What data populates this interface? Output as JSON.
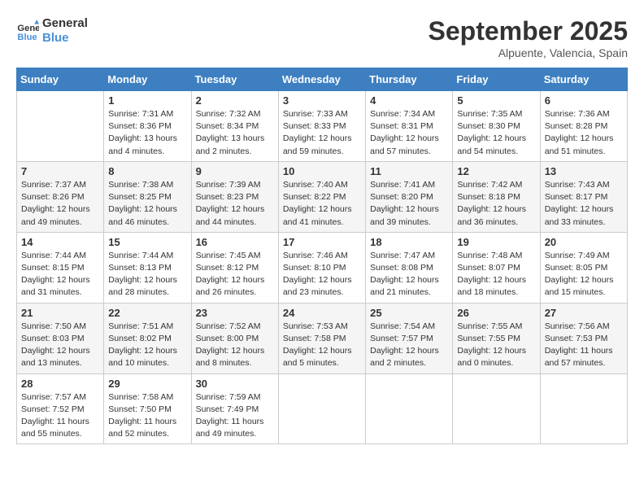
{
  "header": {
    "logo_line1": "General",
    "logo_line2": "Blue",
    "month": "September 2025",
    "location": "Alpuente, Valencia, Spain"
  },
  "days_of_week": [
    "Sunday",
    "Monday",
    "Tuesday",
    "Wednesday",
    "Thursday",
    "Friday",
    "Saturday"
  ],
  "weeks": [
    [
      {
        "day": "",
        "info": ""
      },
      {
        "day": "1",
        "info": "Sunrise: 7:31 AM\nSunset: 8:36 PM\nDaylight: 13 hours\nand 4 minutes."
      },
      {
        "day": "2",
        "info": "Sunrise: 7:32 AM\nSunset: 8:34 PM\nDaylight: 13 hours\nand 2 minutes."
      },
      {
        "day": "3",
        "info": "Sunrise: 7:33 AM\nSunset: 8:33 PM\nDaylight: 12 hours\nand 59 minutes."
      },
      {
        "day": "4",
        "info": "Sunrise: 7:34 AM\nSunset: 8:31 PM\nDaylight: 12 hours\nand 57 minutes."
      },
      {
        "day": "5",
        "info": "Sunrise: 7:35 AM\nSunset: 8:30 PM\nDaylight: 12 hours\nand 54 minutes."
      },
      {
        "day": "6",
        "info": "Sunrise: 7:36 AM\nSunset: 8:28 PM\nDaylight: 12 hours\nand 51 minutes."
      }
    ],
    [
      {
        "day": "7",
        "info": "Sunrise: 7:37 AM\nSunset: 8:26 PM\nDaylight: 12 hours\nand 49 minutes."
      },
      {
        "day": "8",
        "info": "Sunrise: 7:38 AM\nSunset: 8:25 PM\nDaylight: 12 hours\nand 46 minutes."
      },
      {
        "day": "9",
        "info": "Sunrise: 7:39 AM\nSunset: 8:23 PM\nDaylight: 12 hours\nand 44 minutes."
      },
      {
        "day": "10",
        "info": "Sunrise: 7:40 AM\nSunset: 8:22 PM\nDaylight: 12 hours\nand 41 minutes."
      },
      {
        "day": "11",
        "info": "Sunrise: 7:41 AM\nSunset: 8:20 PM\nDaylight: 12 hours\nand 39 minutes."
      },
      {
        "day": "12",
        "info": "Sunrise: 7:42 AM\nSunset: 8:18 PM\nDaylight: 12 hours\nand 36 minutes."
      },
      {
        "day": "13",
        "info": "Sunrise: 7:43 AM\nSunset: 8:17 PM\nDaylight: 12 hours\nand 33 minutes."
      }
    ],
    [
      {
        "day": "14",
        "info": "Sunrise: 7:44 AM\nSunset: 8:15 PM\nDaylight: 12 hours\nand 31 minutes."
      },
      {
        "day": "15",
        "info": "Sunrise: 7:44 AM\nSunset: 8:13 PM\nDaylight: 12 hours\nand 28 minutes."
      },
      {
        "day": "16",
        "info": "Sunrise: 7:45 AM\nSunset: 8:12 PM\nDaylight: 12 hours\nand 26 minutes."
      },
      {
        "day": "17",
        "info": "Sunrise: 7:46 AM\nSunset: 8:10 PM\nDaylight: 12 hours\nand 23 minutes."
      },
      {
        "day": "18",
        "info": "Sunrise: 7:47 AM\nSunset: 8:08 PM\nDaylight: 12 hours\nand 21 minutes."
      },
      {
        "day": "19",
        "info": "Sunrise: 7:48 AM\nSunset: 8:07 PM\nDaylight: 12 hours\nand 18 minutes."
      },
      {
        "day": "20",
        "info": "Sunrise: 7:49 AM\nSunset: 8:05 PM\nDaylight: 12 hours\nand 15 minutes."
      }
    ],
    [
      {
        "day": "21",
        "info": "Sunrise: 7:50 AM\nSunset: 8:03 PM\nDaylight: 12 hours\nand 13 minutes."
      },
      {
        "day": "22",
        "info": "Sunrise: 7:51 AM\nSunset: 8:02 PM\nDaylight: 12 hours\nand 10 minutes."
      },
      {
        "day": "23",
        "info": "Sunrise: 7:52 AM\nSunset: 8:00 PM\nDaylight: 12 hours\nand 8 minutes."
      },
      {
        "day": "24",
        "info": "Sunrise: 7:53 AM\nSunset: 7:58 PM\nDaylight: 12 hours\nand 5 minutes."
      },
      {
        "day": "25",
        "info": "Sunrise: 7:54 AM\nSunset: 7:57 PM\nDaylight: 12 hours\nand 2 minutes."
      },
      {
        "day": "26",
        "info": "Sunrise: 7:55 AM\nSunset: 7:55 PM\nDaylight: 12 hours\nand 0 minutes."
      },
      {
        "day": "27",
        "info": "Sunrise: 7:56 AM\nSunset: 7:53 PM\nDaylight: 11 hours\nand 57 minutes."
      }
    ],
    [
      {
        "day": "28",
        "info": "Sunrise: 7:57 AM\nSunset: 7:52 PM\nDaylight: 11 hours\nand 55 minutes."
      },
      {
        "day": "29",
        "info": "Sunrise: 7:58 AM\nSunset: 7:50 PM\nDaylight: 11 hours\nand 52 minutes."
      },
      {
        "day": "30",
        "info": "Sunrise: 7:59 AM\nSunset: 7:49 PM\nDaylight: 11 hours\nand 49 minutes."
      },
      {
        "day": "",
        "info": ""
      },
      {
        "day": "",
        "info": ""
      },
      {
        "day": "",
        "info": ""
      },
      {
        "day": "",
        "info": ""
      }
    ]
  ]
}
